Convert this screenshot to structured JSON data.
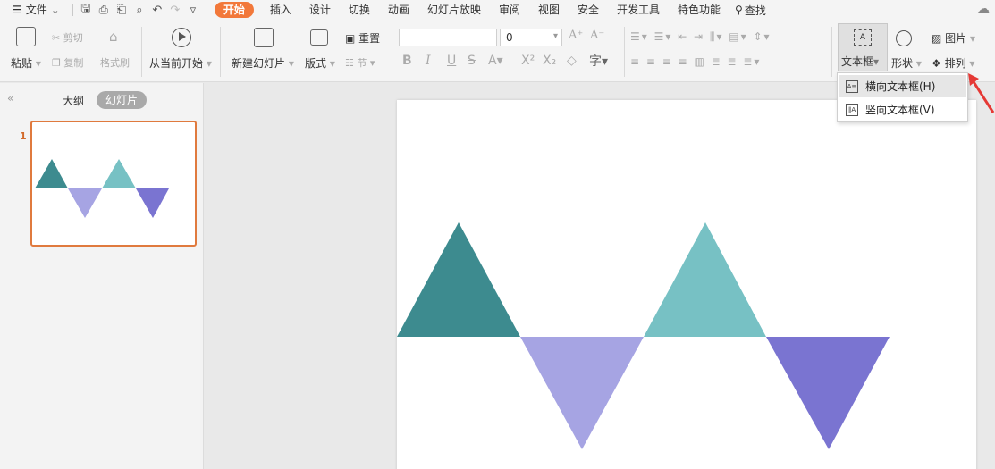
{
  "menubar": {
    "file_label": "文件",
    "tabs": [
      "开始",
      "插入",
      "设计",
      "切换",
      "动画",
      "幻灯片放映",
      "审阅",
      "视图",
      "安全",
      "开发工具",
      "特色功能"
    ],
    "search_label": "查找"
  },
  "ribbon": {
    "clipboard": {
      "paste": "粘贴",
      "cut": "剪切",
      "copy": "复制",
      "format_painter": "格式刷"
    },
    "play_from_current": "从当前开始",
    "new_slide": "新建幻灯片",
    "layout": "版式",
    "reset": "重置",
    "section": "节",
    "font_size_value": "0",
    "textbox": "文本框",
    "shape": "形状",
    "picture": "图片",
    "arrange": "排列"
  },
  "textbox_menu": {
    "items": [
      {
        "label": "横向文本框(H)"
      },
      {
        "label": "竖向文本框(V)"
      }
    ]
  },
  "left_panel": {
    "tab_outline": "大纲",
    "tab_slides": "幻灯片",
    "slide_number": "1"
  },
  "colors": {
    "accent": "#f2783a",
    "teal_dark": "#3d8b8f",
    "teal_light": "#77c1c4",
    "lavender": "#a6a4e3",
    "purple": "#7a74d1"
  }
}
